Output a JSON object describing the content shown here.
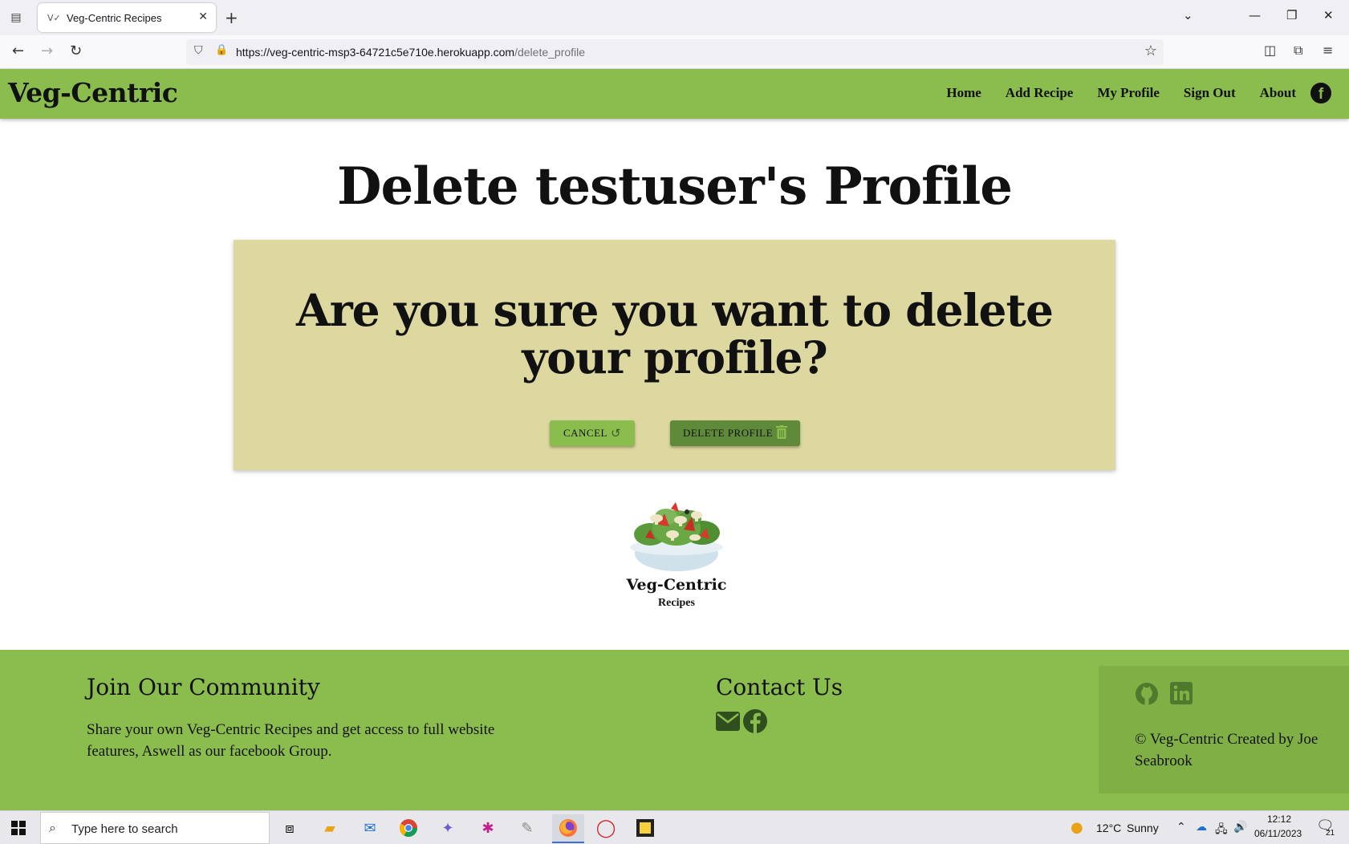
{
  "browser": {
    "tab_title": "Veg-Centric Recipes",
    "tab_favicon": "V✓",
    "url_host": "https://veg-centric-msp3-64721c5e710e.herokuapp.com",
    "url_path": "/delete_profile"
  },
  "header": {
    "brand": "Veg-Centric",
    "nav": [
      "Home",
      "Add Recipe",
      "My Profile",
      "Sign Out",
      "About"
    ],
    "facebook_glyph": "f"
  },
  "main": {
    "title": "Delete testuser's Profile",
    "question": "Are you sure you want to delete your profile?",
    "cancel_label": "CANCEL",
    "delete_label": "DELETE PROFILE",
    "logo_name": "Veg-Centric",
    "logo_sub": "Recipes"
  },
  "footer": {
    "community_heading": "Join Our Community",
    "community_text": "Share your own Veg-Centric Recipes and get access to full website features, Aswell as our facebook Group.",
    "contact_heading": "Contact Us",
    "copyright": "© Veg-Centric Created by Joe Seabrook"
  },
  "taskbar": {
    "search_placeholder": "Type here to search",
    "weather_temp": "12°C",
    "weather_desc": "Sunny",
    "time": "12:12",
    "date": "06/11/2023",
    "notification_count": "21"
  },
  "colors": {
    "header_green": "#8bbd4e",
    "card_beige": "#ddd7a0",
    "delete_green": "#5e8a3a"
  }
}
